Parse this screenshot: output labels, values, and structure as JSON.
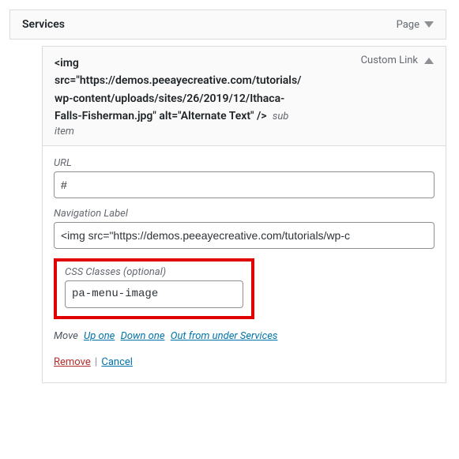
{
  "parent": {
    "title": "Services",
    "type": "Page"
  },
  "child": {
    "title": "<img src=\"https://demos.peeayecreative.com/tutorials/wp-content/uploads/sites/26/2019/12/Ithaca-Falls-Fisherman.jpg\" alt=\"Alternate Text\" />",
    "sub_label": "sub item",
    "type": "Custom Link"
  },
  "fields": {
    "url": {
      "label": "URL",
      "value": "#"
    },
    "nav_label": {
      "label": "Navigation Label",
      "value": "<img src=\"https://demos.peeayecreative.com/tutorials/wp-c"
    },
    "css_classes": {
      "label": "CSS Classes (optional)",
      "value": "pa-menu-image"
    }
  },
  "move": {
    "label": "Move",
    "up": "Up one",
    "down": "Down one",
    "out": "Out from under Services"
  },
  "actions": {
    "remove": "Remove",
    "cancel": "Cancel"
  }
}
